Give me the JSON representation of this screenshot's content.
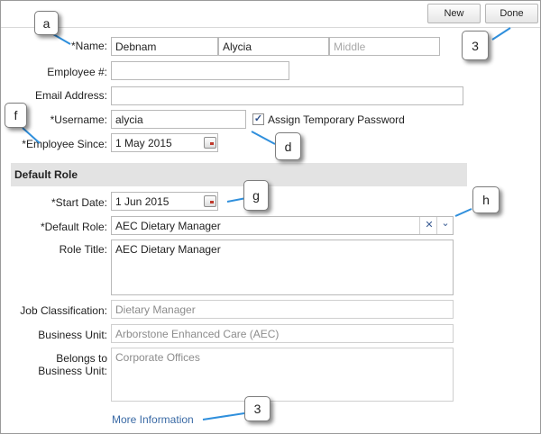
{
  "toolbar": {
    "new_label": "New",
    "done_label": "Done"
  },
  "labels": {
    "name": "*Name:",
    "employee_num": "Employee #:",
    "email": "Email Address:",
    "username": "*Username:",
    "employee_since": "*Employee Since:",
    "start_date": "*Start Date:",
    "default_role": "*Default Role:",
    "role_title": "Role Title:",
    "job_classification": "Job Classification:",
    "business_unit": "Business Unit:",
    "belongs_to_1": "Belongs to",
    "belongs_to_2": "Business Unit:"
  },
  "fields": {
    "last_name": "Debnam",
    "first_name": "Alycia",
    "middle_placeholder": "Middle",
    "employee_num": "",
    "email": "",
    "username": "alycia",
    "employee_since": "1 May 2015",
    "start_date": "1 Jun 2015",
    "default_role": "AEC Dietary Manager",
    "role_title": "AEC Dietary Manager",
    "job_classification": "Dietary Manager",
    "business_unit": "Arborstone Enhanced Care (AEC)",
    "belongs_to_business_unit": "Corporate Offices"
  },
  "assign_temp_password": {
    "label": "Assign Temporary Password",
    "checked": true,
    "mark": "✓"
  },
  "section": {
    "default_role_title": "Default Role"
  },
  "select_icons": {
    "clear": "✕",
    "dropdown": "⌄"
  },
  "more_info_link": "More Information",
  "callouts": {
    "a": "a",
    "three_top": "3",
    "f": "f",
    "d": "d",
    "g": "g",
    "h": "h",
    "three_bottom": "3"
  }
}
